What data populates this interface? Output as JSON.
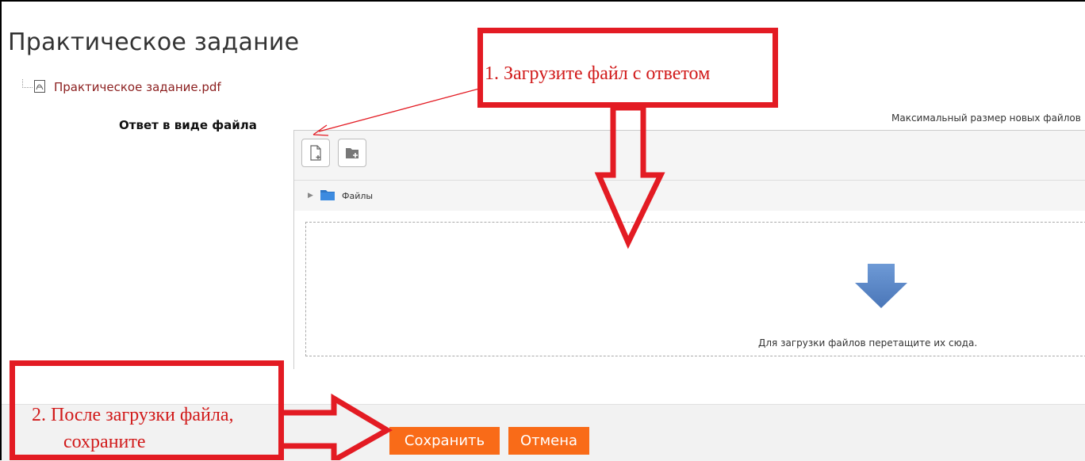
{
  "page": {
    "title": "Практическое задание",
    "attachment": "Практическое задание.pdf",
    "field_label": "Ответ в виде файла",
    "max_size_text": "Максимальный размер новых файлов"
  },
  "filemanager": {
    "path_label": "Файлы",
    "drop_text": "Для загрузки файлов перетащите их сюда."
  },
  "buttons": {
    "save": "Сохранить",
    "cancel": "Отмена"
  },
  "annotations": {
    "step1": "1. Загрузите файл с ответом",
    "step2_line1": "2.  После загрузки файла,",
    "step2_line2": "сохраните"
  },
  "icons": {
    "add_file": "add-file-icon",
    "create_folder": "create-folder-icon",
    "folder": "folder-icon",
    "pdf": "pdf-icon",
    "drop": "down-arrow-icon"
  },
  "colors": {
    "accent": "#f96b18",
    "annotation": "#e31b23",
    "link": "#8b1e1e",
    "drop_arrow": "#5a86c8"
  }
}
